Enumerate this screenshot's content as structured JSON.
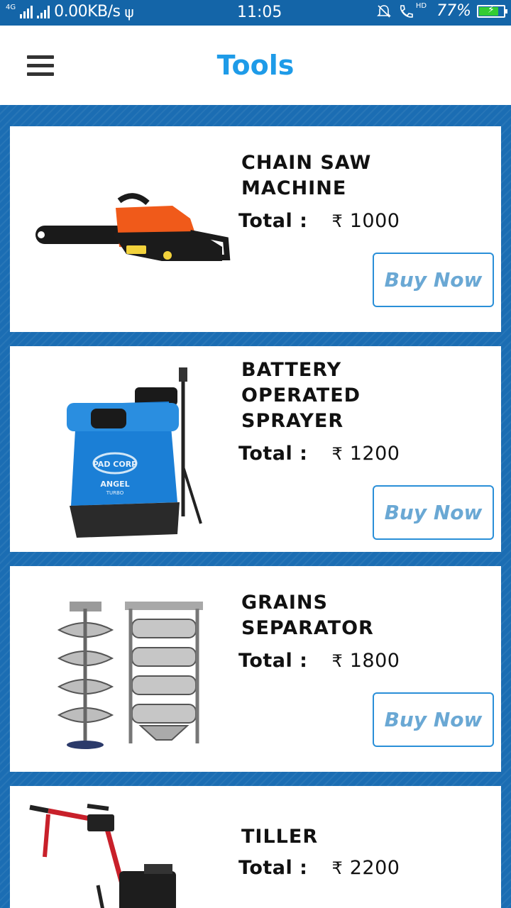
{
  "status_bar": {
    "network": "4G",
    "speed": "0.00KB/s",
    "time": "11:05",
    "hd": "HD",
    "battery": "77%"
  },
  "app_bar": {
    "title": "Tools"
  },
  "colors": {
    "accent": "#1e9be8",
    "background": "#1b6db3",
    "button_border": "#2a8fd8",
    "button_text": "#6aa8d4"
  },
  "products": [
    {
      "name": "CHAIN SAW MACHINE",
      "total_label": "Total :",
      "currency": "₹",
      "price": "1000",
      "buy_label": "Buy Now",
      "image": "chain-saw"
    },
    {
      "name": "BATTERY OPERATED SPRAYER",
      "total_label": "Total :",
      "currency": "₹",
      "price": "1200",
      "buy_label": "Buy Now",
      "image": "battery-sprayer"
    },
    {
      "name": "GRAINS SEPARATOR",
      "total_label": "Total :",
      "currency": "₹",
      "price": "1800",
      "buy_label": "Buy Now",
      "image": "grains-separator"
    },
    {
      "name": "TILLER",
      "total_label": "Total :",
      "currency": "₹",
      "price": "2200",
      "image": "tiller"
    }
  ]
}
